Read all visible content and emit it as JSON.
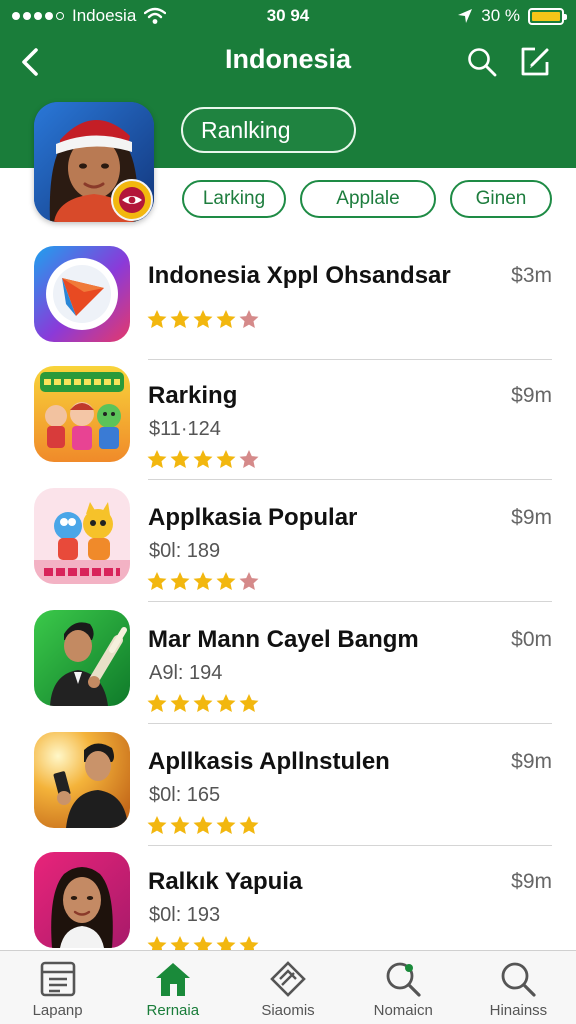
{
  "status_bar": {
    "carrier": "Indoesia",
    "time": "30 94",
    "battery_text": "30 %"
  },
  "nav": {
    "title": "Indonesia"
  },
  "hero": {
    "chip_label": "Ranlking"
  },
  "filter_chips": [
    {
      "label": "Larking"
    },
    {
      "label": "Applale"
    },
    {
      "label": "Ginen"
    }
  ],
  "apps": [
    {
      "title": "Indonesia Xppl Ohsandsar",
      "price": "$3m",
      "subtitle": "",
      "rating": 4.5
    },
    {
      "title": "Rarking",
      "price": "$9m",
      "subtitle": "$11·124",
      "rating": 4.5
    },
    {
      "title": "Applkasia Popular",
      "price": "$9m",
      "subtitle": "$0l: 189",
      "rating": 4.0
    },
    {
      "title": "Mar Mann Cayel Bangm",
      "price": "$0m",
      "subtitle": "A9l: 194",
      "rating": 5.0
    },
    {
      "title": "Apllkasis Apllnstulen",
      "price": "$9m",
      "subtitle": "$0l: 165",
      "rating": 5.0
    },
    {
      "title": "Ralkık Yapuia",
      "price": "$9m",
      "subtitle": "$0l: 193",
      "rating": 5.0
    }
  ],
  "tabs": [
    {
      "label": "Lapanp",
      "icon": "list-icon",
      "active": false
    },
    {
      "label": "Rernaia",
      "icon": "home-icon",
      "active": true
    },
    {
      "label": "Siaomis",
      "icon": "diamond-icon",
      "active": false
    },
    {
      "label": "Nomaicn",
      "icon": "search-icon",
      "active": false
    },
    {
      "label": "Hinainss",
      "icon": "search-icon",
      "active": false
    }
  ],
  "colors": {
    "brand": "#1a7d3a",
    "star": "#f2b70f",
    "star_empty": "#d58a8a"
  }
}
